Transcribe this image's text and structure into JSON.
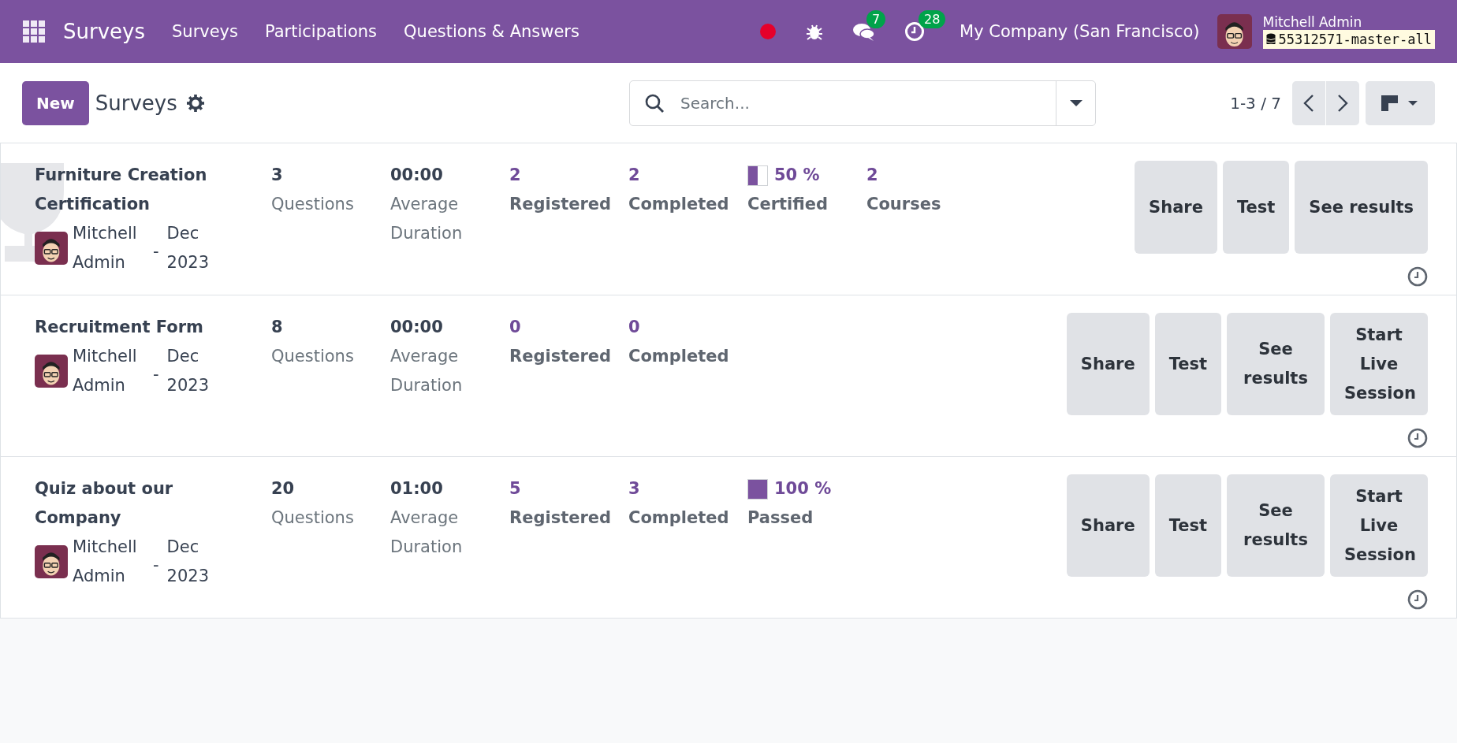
{
  "topbar": {
    "app_name": "Surveys",
    "menu": [
      "Surveys",
      "Participations",
      "Questions & Answers"
    ],
    "messages_badge": "7",
    "activities_badge": "28",
    "company": "My Company (San Francisco)",
    "user": "Mitchell Admin",
    "database": "55312571-master-all"
  },
  "control_panel": {
    "new_button": "New",
    "breadcrumb": "Surveys",
    "search_placeholder": "Search...",
    "pager": "1-3 / 7"
  },
  "surveys": [
    {
      "title": "Furniture Creation Certification",
      "certification": true,
      "author": "Mitchell Admin",
      "separator": "-",
      "date": "Dec 2023",
      "stats": [
        {
          "kind": "plain",
          "value": "3",
          "label": "Questions"
        },
        {
          "kind": "plain",
          "value": "00:00",
          "label": "Average Duration"
        },
        {
          "kind": "link",
          "value": "2",
          "label": "Registered"
        },
        {
          "kind": "link",
          "value": "2",
          "label": "Completed"
        },
        {
          "kind": "rate",
          "value": "50 %",
          "level": 0.5,
          "label": "Certified"
        },
        {
          "kind": "link",
          "value": "2",
          "label": "Courses"
        }
      ],
      "buttons": [
        "Share",
        "Test",
        "See results"
      ]
    },
    {
      "title": "Recruitment Form",
      "certification": false,
      "author": "Mitchell Admin",
      "separator": "-",
      "date": "Dec 2023",
      "stats": [
        {
          "kind": "plain",
          "value": "8",
          "label": "Questions"
        },
        {
          "kind": "plain",
          "value": "00:00",
          "label": "Average Duration"
        },
        {
          "kind": "link",
          "value": "0",
          "label": "Registered"
        },
        {
          "kind": "link",
          "value": "0",
          "label": "Completed"
        }
      ],
      "buttons": [
        "Share",
        "Test",
        "See results",
        "Start Live Session"
      ]
    },
    {
      "title": "Quiz about our Company",
      "certification": false,
      "author": "Mitchell Admin",
      "separator": "-",
      "date": "Dec 2023",
      "stats": [
        {
          "kind": "plain",
          "value": "20",
          "label": "Questions"
        },
        {
          "kind": "plain",
          "value": "01:00",
          "label": "Average Duration"
        },
        {
          "kind": "link",
          "value": "5",
          "label": "Registered"
        },
        {
          "kind": "link",
          "value": "3",
          "label": "Completed"
        },
        {
          "kind": "rate",
          "value": "100 %",
          "level": 1,
          "label": "Passed"
        }
      ],
      "buttons": [
        "Share",
        "Test",
        "See results",
        "Start Live Session"
      ]
    }
  ]
}
